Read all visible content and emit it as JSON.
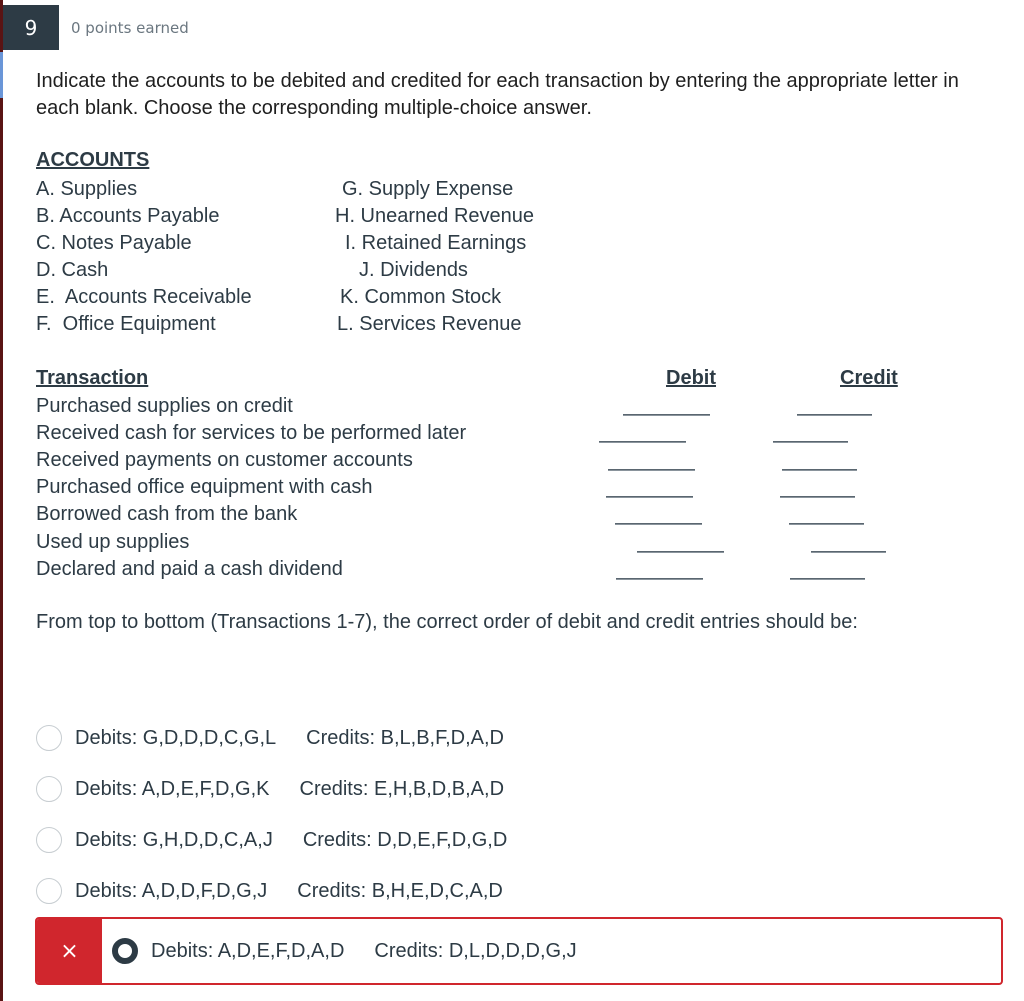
{
  "question": {
    "number": "9",
    "points_text": "0 points earned",
    "prompt": "Indicate the accounts to be debited and credited for each transaction by entering the appropriate letter in each blank. Choose the corresponding multiple-choice answer."
  },
  "accounts": {
    "title": "ACCOUNTS",
    "left": [
      "A. Supplies",
      "B. Accounts Payable",
      "C. Notes Payable",
      "D. Cash",
      "E.  Accounts Receivable",
      "F.  Office Equipment"
    ],
    "right": [
      "G. Supply Expense",
      "H. Unearned Revenue",
      "I. Retained Earnings",
      "J. Dividends",
      "K. Common Stock",
      "L. Services Revenue"
    ]
  },
  "transactions": {
    "title": "Transaction",
    "debit_header": "Debit",
    "credit_header": "Credit",
    "items": [
      "Purchased supplies on credit",
      "Received cash for services to be performed later",
      "Received payments on customer accounts",
      "Purchased office equipment with cash",
      "Borrowed cash from the bank",
      "Used up supplies",
      "Declared and paid a cash dividend"
    ]
  },
  "instruction": "From top to bottom (Transactions 1-7), the correct order of debit and credit entries should be:",
  "options": [
    {
      "debits": "Debits: G,D,D,D,C,G,L",
      "credits": "Credits: B,L,B,F,D,A,D",
      "selected": false
    },
    {
      "debits": "Debits: A,D,E,F,D,G,K",
      "credits": "Credits: E,H,B,D,B,A,D",
      "selected": false
    },
    {
      "debits": "Debits: G,H,D,D,C,A,J",
      "credits": "Credits: D,D,E,F,D,G,D",
      "selected": false
    },
    {
      "debits": "Debits: A,D,D,F,D,G,J",
      "credits": "Credits: B,H,E,D,C,A,D",
      "selected": false
    },
    {
      "debits": "Debits: A,D,E,F,D,A,D",
      "credits": "Credits: D,L,D,D,D,G,J",
      "selected": true,
      "status": "incorrect"
    }
  ],
  "feedback": {
    "incorrect_icon": "×",
    "incorrect_color": "#d0262d"
  }
}
